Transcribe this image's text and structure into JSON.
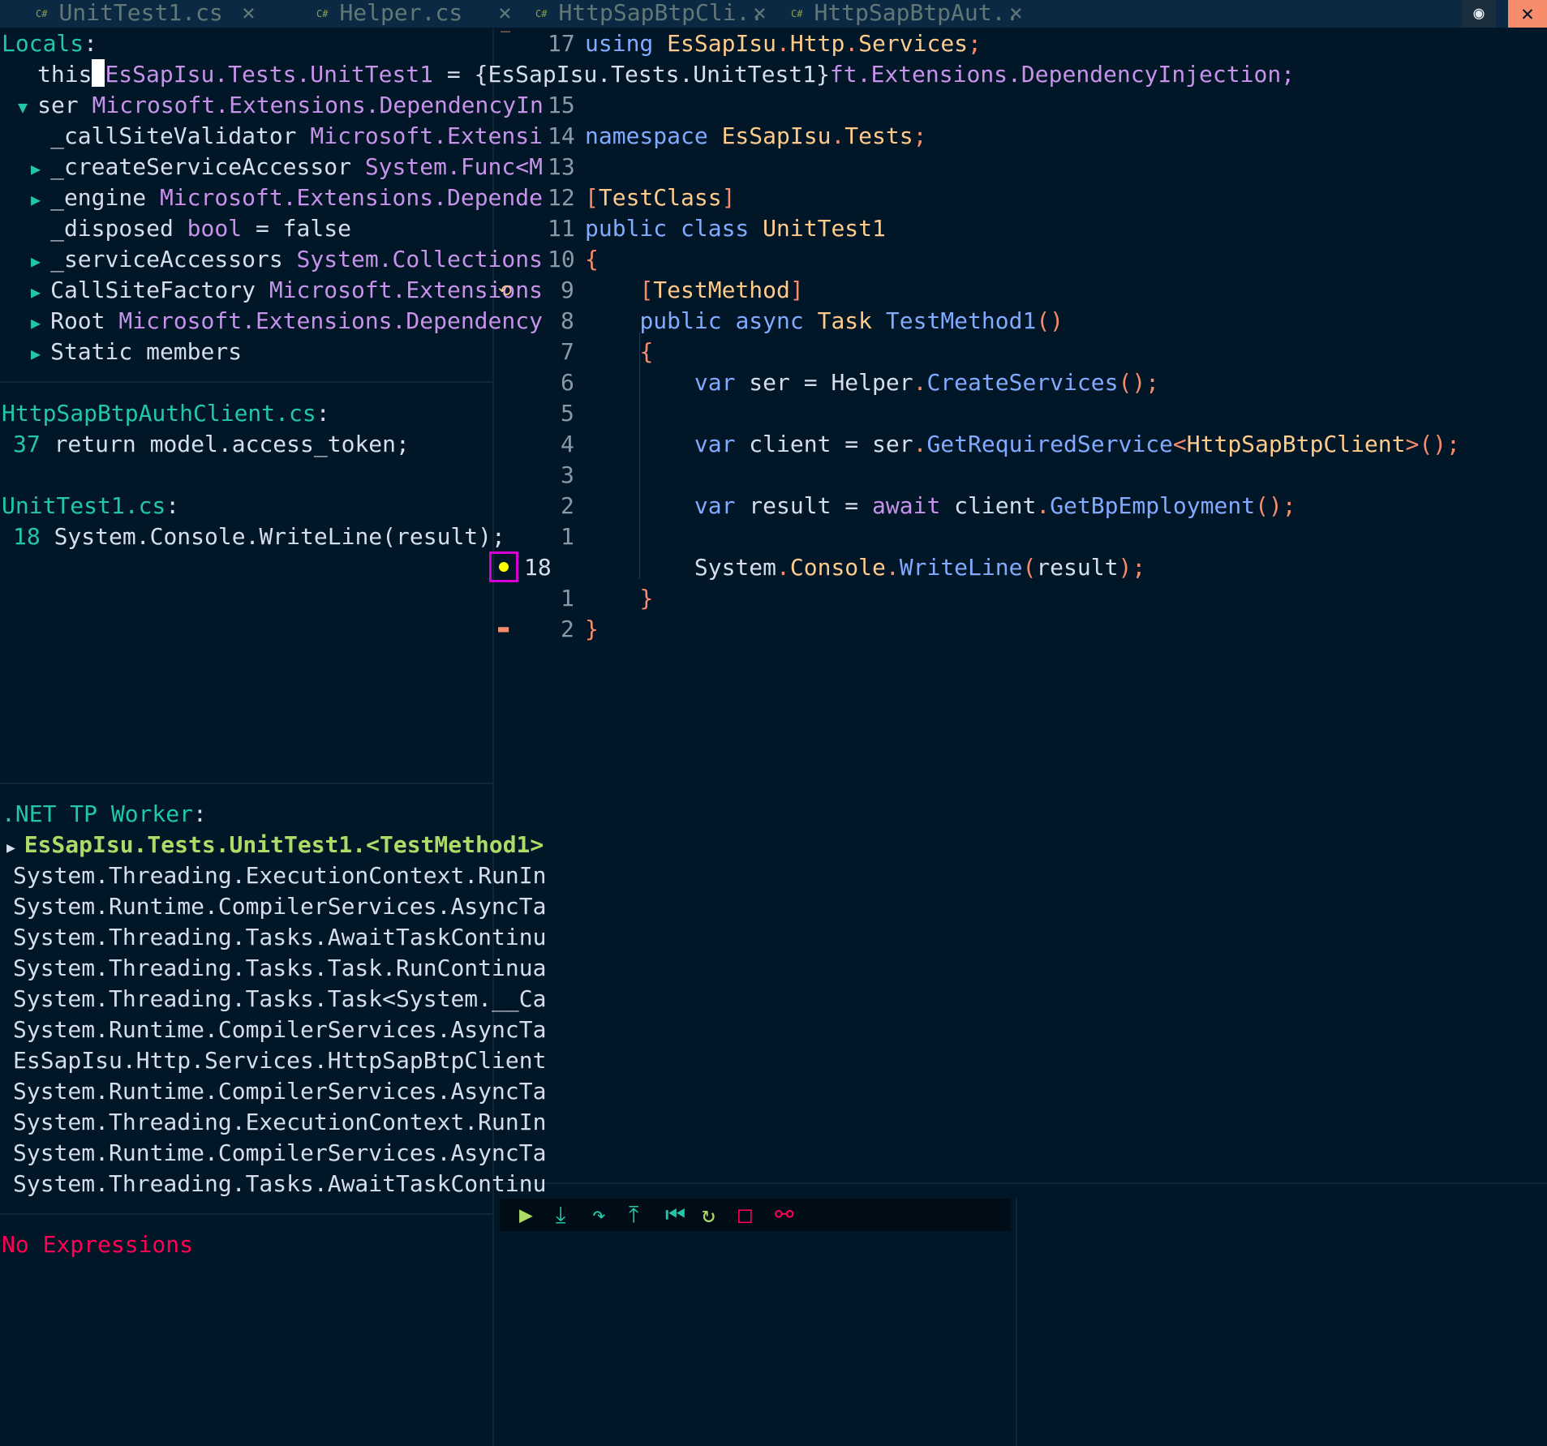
{
  "tabs": [
    {
      "icon": "C#",
      "label": "UnitTest1.cs",
      "close": "×"
    },
    {
      "icon": "C#",
      "label": "Helper.cs",
      "close": "×"
    },
    {
      "icon": "C#",
      "label": "HttpSapBtpCli..",
      "close": "×"
    },
    {
      "icon": "C#",
      "label": "HttpSapBtpAut..",
      "close": "×"
    }
  ],
  "window": {
    "toggle_icon": "eye-icon",
    "toggle": "◉",
    "close": "✕"
  },
  "locals": {
    "header": "Locals",
    "this": {
      "name": "this",
      "type": "EsSapIsu.Tests.UnitTest1",
      "value": " = {EsSapIsu.Tests.UnitTest1}"
    },
    "ser": {
      "name": "ser",
      "type": "Microsoft.Extensions.DependencyIn"
    },
    "items": [
      {
        "name": "_callSiteValidator",
        "type": "Microsoft.Extensi",
        "value": ""
      },
      {
        "name": "_createServiceAccessor",
        "type": "System.Func<M",
        "value": ""
      },
      {
        "name": "_engine",
        "type": "Microsoft.Extensions.Depende",
        "value": ""
      },
      {
        "name": "_disposed",
        "type": "bool",
        "value": " = false"
      },
      {
        "name": "_serviceAccessors",
        "type": "System.Collections",
        "value": ""
      },
      {
        "name": "CallSiteFactory",
        "type": "Microsoft.Extensions",
        "value": ""
      },
      {
        "name": "Root",
        "type": "Microsoft.Extensions.Dependency",
        "value": ""
      },
      {
        "name": "Static members",
        "type": "",
        "value": ""
      }
    ]
  },
  "breakpoints": {
    "files": [
      {
        "file": "HttpSapBtpAuthClient.cs",
        "line": "37",
        "code": "return model.access_token;"
      },
      {
        "file": "UnitTest1.cs",
        "line": "18",
        "code": "System.Console.WriteLine(result);"
      }
    ]
  },
  "stacks": {
    "thread": ".NET TP Worker",
    "current": "EsSapIsu.Tests.UnitTest1.<TestMethod1>",
    "frames": [
      "System.Threading.ExecutionContext.RunIn",
      "System.Runtime.CompilerServices.AsyncTa",
      "System.Threading.Tasks.AwaitTaskContinu",
      "System.Threading.Tasks.Task.RunContinua",
      "System.Threading.Tasks.Task<System.__Ca",
      "System.Runtime.CompilerServices.AsyncTa",
      "EsSapIsu.Http.Services.HttpSapBtpClient",
      "System.Runtime.CompilerServices.AsyncTa",
      "System.Threading.ExecutionContext.RunIn",
      "System.Runtime.CompilerServices.AsyncTa",
      "System.Threading.Tasks.AwaitTaskContinu"
    ]
  },
  "watches": {
    "empty": "No Expressions"
  },
  "editor": {
    "overflow": "ft.Extensions.DependencyInjection;",
    "lines": [
      {
        "n": "17",
        "t": [
          [
            "blue",
            "using "
          ],
          [
            "yellow",
            "EsSapIsu"
          ],
          [
            "orange",
            "."
          ],
          [
            "yellow",
            "Http"
          ],
          [
            "orange",
            "."
          ],
          [
            "yellow",
            "Services"
          ],
          [
            "orange",
            ";"
          ]
        ]
      },
      {
        "n": "",
        "t": []
      },
      {
        "n": "15",
        "t": []
      },
      {
        "n": "14",
        "t": [
          [
            "blue",
            "namespace "
          ],
          [
            "yellow",
            "EsSapIsu"
          ],
          [
            "orange",
            "."
          ],
          [
            "yellow",
            "Tests"
          ],
          [
            "orange",
            ";"
          ]
        ]
      },
      {
        "n": "13",
        "t": []
      },
      {
        "n": "12",
        "t": [
          [
            "orange",
            "["
          ],
          [
            "yellow",
            "TestClass"
          ],
          [
            "orange",
            "]"
          ]
        ]
      },
      {
        "n": "11",
        "t": [
          [
            "blue",
            "public class "
          ],
          [
            "yellow",
            "UnitTest1"
          ]
        ]
      },
      {
        "n": "10",
        "t": [
          [
            "orange",
            "{"
          ]
        ]
      },
      {
        "n": "9",
        "t": [
          [
            "white",
            "    "
          ],
          [
            "orange",
            "["
          ],
          [
            "yellow",
            "TestMethod"
          ],
          [
            "orange",
            "]"
          ]
        ]
      },
      {
        "n": "8",
        "t": [
          [
            "white",
            "    "
          ],
          [
            "blue",
            "public async "
          ],
          [
            "yellow",
            "Task "
          ],
          [
            "blue",
            "TestMethod1"
          ],
          [
            "orange",
            "()"
          ]
        ]
      },
      {
        "n": "7",
        "t": [
          [
            "white",
            "    "
          ],
          [
            "orange",
            "{"
          ]
        ]
      },
      {
        "n": "6",
        "t": [
          [
            "white",
            "        "
          ],
          [
            "blue",
            "var "
          ],
          [
            "white",
            "ser = Helper"
          ],
          [
            "orange",
            "."
          ],
          [
            "blue",
            "CreateServices"
          ],
          [
            "orange",
            "();"
          ]
        ]
      },
      {
        "n": "5",
        "t": []
      },
      {
        "n": "4",
        "t": [
          [
            "white",
            "        "
          ],
          [
            "blue",
            "var "
          ],
          [
            "white",
            "client = ser"
          ],
          [
            "orange",
            "."
          ],
          [
            "blue",
            "GetRequiredService"
          ],
          [
            "orange",
            "<"
          ],
          [
            "yellow",
            "HttpSapBtpClient"
          ],
          [
            "orange",
            ">();"
          ]
        ]
      },
      {
        "n": "3",
        "t": []
      },
      {
        "n": "2",
        "t": [
          [
            "white",
            "        "
          ],
          [
            "blue",
            "var "
          ],
          [
            "white",
            "result = "
          ],
          [
            "purple",
            "await "
          ],
          [
            "white",
            "client"
          ],
          [
            "orange",
            "."
          ],
          [
            "blue",
            "GetBpEmployment"
          ],
          [
            "orange",
            "();"
          ]
        ]
      },
      {
        "n": "1",
        "t": []
      },
      {
        "n": "18",
        "t": [
          [
            "white",
            "        System"
          ],
          [
            "orange",
            "."
          ],
          [
            "yellow",
            "Console"
          ],
          [
            "orange",
            "."
          ],
          [
            "blue",
            "WriteLine"
          ],
          [
            "orange",
            "("
          ],
          [
            "white",
            "result"
          ],
          [
            "orange",
            ");"
          ]
        ]
      },
      {
        "n": "1",
        "t": [
          [
            "white",
            "    "
          ],
          [
            "orange",
            "}"
          ]
        ]
      },
      {
        "n": "2",
        "t": [
          [
            "orange",
            "}"
          ]
        ]
      }
    ]
  },
  "dap_controls": [
    {
      "name": "continue-icon",
      "glyph": "▶",
      "color": "#addb67"
    },
    {
      "name": "step-into-icon",
      "glyph": "⤓",
      "color": "#21c7a8"
    },
    {
      "name": "step-over-icon",
      "glyph": "↷",
      "color": "#21c7a8"
    },
    {
      "name": "step-out-icon",
      "glyph": "⤒",
      "color": "#21c7a8"
    },
    {
      "name": "step-back-icon",
      "glyph": "⏮",
      "color": "#21c7a8"
    },
    {
      "name": "restart-icon",
      "glyph": "↻",
      "color": "#addb67"
    },
    {
      "name": "stop-icon",
      "glyph": "□",
      "color": "#ff0055"
    },
    {
      "name": "disconnect-icon",
      "glyph": "⚯",
      "color": "#ff0055"
    }
  ]
}
